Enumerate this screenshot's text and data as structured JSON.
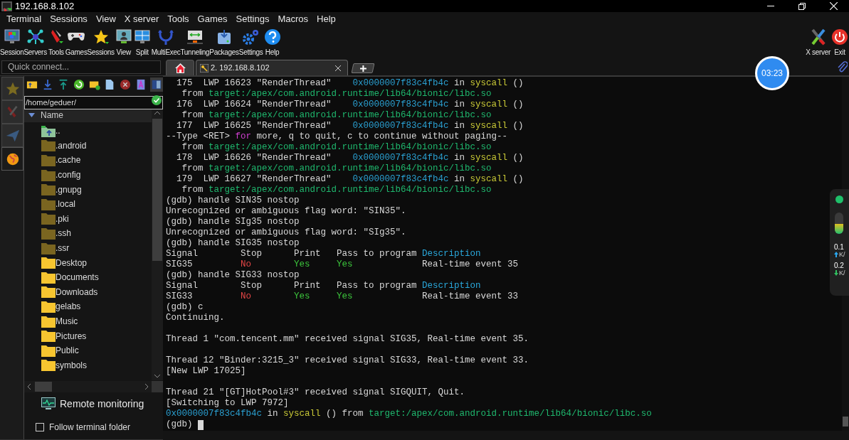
{
  "window": {
    "title": "192.168.8.102"
  },
  "menu": [
    "Terminal",
    "Sessions",
    "View",
    "X server",
    "Tools",
    "Games",
    "Settings",
    "Macros",
    "Help"
  ],
  "toolbar": [
    "Session",
    "Servers",
    "Tools",
    "Games",
    "Sessions",
    "View",
    "Split",
    "MultiExec",
    "Tunneling",
    "Packages",
    "Settings",
    "Help"
  ],
  "toolbar_right": [
    "X server",
    "Exit"
  ],
  "quick_connect": {
    "placeholder": "Quick connect..."
  },
  "side_tabs": [
    {
      "selected": false
    },
    {
      "selected": false
    },
    {
      "selected": false
    },
    {
      "selected": true
    }
  ],
  "file_browser": {
    "path": "/home/geduer/",
    "column": "Name",
    "items": [
      {
        "name": "..",
        "kind": "parent"
      },
      {
        "name": ".android",
        "kind": "hidden"
      },
      {
        "name": ".cache",
        "kind": "hidden"
      },
      {
        "name": ".config",
        "kind": "hidden"
      },
      {
        "name": ".gnupg",
        "kind": "hidden"
      },
      {
        "name": ".local",
        "kind": "hidden"
      },
      {
        "name": ".pki",
        "kind": "hidden"
      },
      {
        "name": ".ssh",
        "kind": "hidden"
      },
      {
        "name": ".ssr",
        "kind": "hidden"
      },
      {
        "name": "Desktop",
        "kind": "folder"
      },
      {
        "name": "Documents",
        "kind": "folder"
      },
      {
        "name": "Downloads",
        "kind": "folder"
      },
      {
        "name": "gelabs",
        "kind": "folder"
      },
      {
        "name": "Music",
        "kind": "folder"
      },
      {
        "name": "Pictures",
        "kind": "folder"
      },
      {
        "name": "Public",
        "kind": "folder"
      },
      {
        "name": "symbols",
        "kind": "folder"
      }
    ]
  },
  "remote_monitoring": "Remote monitoring",
  "follow_terminal_folder": {
    "label": "Follow terminal folder",
    "checked": false
  },
  "tabs": [
    {
      "kind": "home",
      "selected": false
    },
    {
      "kind": "session",
      "label": "2. 192.168.8.102",
      "selected": true
    }
  ],
  "timer": "03:23",
  "network": {
    "up": "0.1",
    "up_unit": "K/",
    "down": "0.2",
    "down_unit": "K/"
  },
  "terminal": [
    {
      "kind": "text",
      "segments": [
        {
          "text": "  175  LWP 16623 \"RenderThread\"    ",
          "color": "#d8d8d8"
        },
        {
          "text": "0x0000007f83c4fb4c",
          "color": "#2a9fd0"
        },
        {
          "text": " in ",
          "color": "#d8d8d8"
        },
        {
          "text": "syscall",
          "color": "#c9c936"
        },
        {
          "text": " ()",
          "color": "#d8d8d8"
        }
      ]
    },
    {
      "kind": "text",
      "segments": [
        {
          "text": "   from ",
          "color": "#d8d8d8"
        },
        {
          "text": "target:/apex/com.android.runtime/lib64/bionic/libc.so",
          "color": "#1fb86e"
        }
      ]
    },
    {
      "kind": "text",
      "segments": [
        {
          "text": "  176  LWP 16624 \"RenderThread\"    ",
          "color": "#d8d8d8"
        },
        {
          "text": "0x0000007f83c4fb4c",
          "color": "#2a9fd0"
        },
        {
          "text": " in ",
          "color": "#d8d8d8"
        },
        {
          "text": "syscall",
          "color": "#c9c936"
        },
        {
          "text": " ()",
          "color": "#d8d8d8"
        }
      ]
    },
    {
      "kind": "text",
      "segments": [
        {
          "text": "   from ",
          "color": "#d8d8d8"
        },
        {
          "text": "target:/apex/com.android.runtime/lib64/bionic/libc.so",
          "color": "#1fb86e"
        }
      ]
    },
    {
      "kind": "text",
      "segments": [
        {
          "text": "  177  LWP 16625 \"RenderThread\"    ",
          "color": "#d8d8d8"
        },
        {
          "text": "0x0000007f83c4fb4c",
          "color": "#2a9fd0"
        },
        {
          "text": " in ",
          "color": "#d8d8d8"
        },
        {
          "text": "syscall",
          "color": "#c9c936"
        },
        {
          "text": " ()",
          "color": "#d8d8d8"
        }
      ]
    },
    {
      "kind": "text",
      "segments": [
        {
          "text": "--Type <RET> ",
          "color": "#d8d8d8"
        },
        {
          "text": "for",
          "color": "#d03fd0"
        },
        {
          "text": " more, q to quit, c to continue without paging--",
          "color": "#d8d8d8"
        }
      ]
    },
    {
      "kind": "text",
      "segments": [
        {
          "text": "   from ",
          "color": "#d8d8d8"
        },
        {
          "text": "target:/apex/com.android.runtime/lib64/bionic/libc.so",
          "color": "#1fb86e"
        }
      ]
    },
    {
      "kind": "text",
      "segments": [
        {
          "text": "  178  LWP 16626 \"RenderThread\"    ",
          "color": "#d8d8d8"
        },
        {
          "text": "0x0000007f83c4fb4c",
          "color": "#2a9fd0"
        },
        {
          "text": " in ",
          "color": "#d8d8d8"
        },
        {
          "text": "syscall",
          "color": "#c9c936"
        },
        {
          "text": " ()",
          "color": "#d8d8d8"
        }
      ]
    },
    {
      "kind": "text",
      "segments": [
        {
          "text": "   from ",
          "color": "#d8d8d8"
        },
        {
          "text": "target:/apex/com.android.runtime/lib64/bionic/libc.so",
          "color": "#1fb86e"
        }
      ]
    },
    {
      "kind": "text",
      "segments": [
        {
          "text": "  179  LWP 16627 \"RenderThread\"    ",
          "color": "#d8d8d8"
        },
        {
          "text": "0x0000007f83c4fb4c",
          "color": "#2a9fd0"
        },
        {
          "text": " in ",
          "color": "#d8d8d8"
        },
        {
          "text": "syscall",
          "color": "#c9c936"
        },
        {
          "text": " ()",
          "color": "#d8d8d8"
        }
      ]
    },
    {
      "kind": "text",
      "segments": [
        {
          "text": "   from ",
          "color": "#d8d8d8"
        },
        {
          "text": "target:/apex/com.android.runtime/lib64/bionic/libc.so",
          "color": "#1fb86e"
        }
      ]
    },
    {
      "kind": "text",
      "segments": [
        {
          "text": "(gdb) handle SIN35 nostop",
          "color": "#d8d8d8"
        }
      ]
    },
    {
      "kind": "text",
      "segments": [
        {
          "text": "Unrecognized or ambiguous flag word: \"SIN35\".",
          "color": "#d8d8d8"
        }
      ]
    },
    {
      "kind": "text",
      "segments": [
        {
          "text": "(gdb) handle SIg35 nostop",
          "color": "#d8d8d8"
        }
      ]
    },
    {
      "kind": "text",
      "segments": [
        {
          "text": "Unrecognized or ambiguous flag word: \"SIg35\".",
          "color": "#d8d8d8"
        }
      ]
    },
    {
      "kind": "text",
      "segments": [
        {
          "text": "(gdb) handle SIG35 nostop",
          "color": "#d8d8d8"
        }
      ]
    },
    {
      "kind": "text",
      "segments": [
        {
          "text": "Signal        Stop      Print   Pass to program ",
          "color": "#d8d8d8"
        },
        {
          "text": "Description",
          "color": "#2aa8dc"
        }
      ]
    },
    {
      "kind": "text",
      "segments": [
        {
          "text": "SIG35         ",
          "color": "#d8d8d8"
        },
        {
          "text": "No        ",
          "color": "#e04545"
        },
        {
          "text": "Yes     ",
          "color": "#3cc43c"
        },
        {
          "text": "Yes             ",
          "color": "#3cc43c"
        },
        {
          "text": "Real-time event 35",
          "color": "#d8d8d8"
        }
      ]
    },
    {
      "kind": "text",
      "segments": [
        {
          "text": "(gdb) handle SIG33 nostop",
          "color": "#d8d8d8"
        }
      ]
    },
    {
      "kind": "text",
      "segments": [
        {
          "text": "Signal        Stop      Print   Pass to program ",
          "color": "#d8d8d8"
        },
        {
          "text": "Description",
          "color": "#2aa8dc"
        }
      ]
    },
    {
      "kind": "text",
      "segments": [
        {
          "text": "SIG33         ",
          "color": "#d8d8d8"
        },
        {
          "text": "No        ",
          "color": "#e04545"
        },
        {
          "text": "Yes     ",
          "color": "#3cc43c"
        },
        {
          "text": "Yes             ",
          "color": "#3cc43c"
        },
        {
          "text": "Real-time event 33",
          "color": "#d8d8d8"
        }
      ]
    },
    {
      "kind": "text",
      "segments": [
        {
          "text": "(gdb) c",
          "color": "#d8d8d8"
        }
      ]
    },
    {
      "kind": "text",
      "segments": [
        {
          "text": "Continuing.",
          "color": "#d8d8d8"
        }
      ]
    },
    {
      "kind": "blank"
    },
    {
      "kind": "text",
      "segments": [
        {
          "text": "Thread 1 \"com.tencent.mm\" received signal SIG35, Real-time event 35.",
          "color": "#d8d8d8"
        }
      ]
    },
    {
      "kind": "blank"
    },
    {
      "kind": "text",
      "segments": [
        {
          "text": "Thread 12 \"Binder:3215_3\" received signal SIG33, Real-time event 33.",
          "color": "#d8d8d8"
        }
      ]
    },
    {
      "kind": "text",
      "segments": [
        {
          "text": "[New LWP 17025]",
          "color": "#d8d8d8"
        }
      ]
    },
    {
      "kind": "blank"
    },
    {
      "kind": "text",
      "segments": [
        {
          "text": "Thread 21 \"[GT]HotPool#3\" received signal SIGQUIT, Quit.",
          "color": "#d8d8d8"
        }
      ]
    },
    {
      "kind": "text",
      "segments": [
        {
          "text": "[Switching to LWP 7972]",
          "color": "#d8d8d8"
        }
      ]
    },
    {
      "kind": "text",
      "segments": [
        {
          "text": "0x0000007f83c4fb4c",
          "color": "#2a9fd0"
        },
        {
          "text": " in ",
          "color": "#d8d8d8"
        },
        {
          "text": "syscall",
          "color": "#c9c936"
        },
        {
          "text": " () from ",
          "color": "#d8d8d8"
        },
        {
          "text": "target:/apex/com.android.runtime/lib64/bionic/libc.so",
          "color": "#1fb86e"
        }
      ]
    },
    {
      "kind": "prompt",
      "segments": [
        {
          "text": "(gdb) ",
          "color": "#d8d8d8"
        }
      ]
    }
  ]
}
